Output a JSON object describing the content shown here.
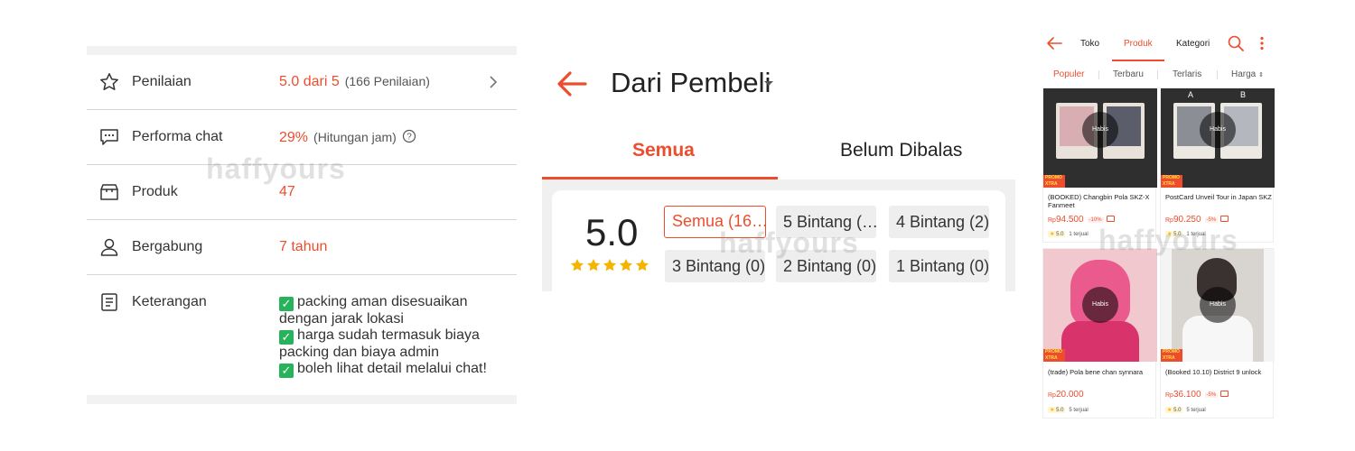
{
  "watermark": "haffyours",
  "shop_info": {
    "rows": [
      {
        "label": "Penilaian",
        "value": "5.0 dari 5",
        "sub": "(166 Penilaian)"
      },
      {
        "label": "Performa chat",
        "value": "29%",
        "sub": "(Hitungan jam)"
      },
      {
        "label": "Produk",
        "value": "47"
      },
      {
        "label": "Bergabung",
        "value": "7 tahun"
      },
      {
        "label": "Keterangan"
      }
    ],
    "description": [
      "packing aman disesuaikan",
      "dengan jarak lokasi",
      "harga sudah termasuk biaya",
      "packing dan biaya admin",
      "boleh lihat detail melalui chat!"
    ]
  },
  "ratings": {
    "title": "Dari Pembeli",
    "tabs": [
      "Semua",
      "Belum Dibalas"
    ],
    "score": "5.0",
    "stars": 5,
    "filters": [
      "Semua (16…",
      "5 Bintang (…",
      "4 Bintang (2)",
      "3 Bintang (0)",
      "2 Bintang (0)",
      "1 Bintang (0)"
    ]
  },
  "shop_nav": {
    "tabs": [
      "Toko",
      "Produk",
      "Kategori"
    ],
    "sort": [
      "Populer",
      "Terbaru",
      "Terlaris",
      "Harga"
    ],
    "products": [
      {
        "title": "(BOOKED) Changbin Pola SKZ-X Fanmeet",
        "currency": "Rp",
        "price": "94.500",
        "discount": "-10%",
        "rating": "5.0",
        "sold": "1 terjual",
        "status": "Habis",
        "badge": "PROMO XTRA"
      },
      {
        "title": "PostCard Unveil Tour in Japan SKZ",
        "currency": "Rp",
        "price": "90.250",
        "discount": "-5%",
        "rating": "5.0",
        "sold": "1 terjual",
        "status": "Habis",
        "badge": "PROMO XTRA",
        "img_labels": [
          "A",
          "B"
        ]
      },
      {
        "title": "(trade) Pola bene chan synnara",
        "currency": "Rp",
        "price": "20.000",
        "rating": "5.0",
        "sold": "5 terjual",
        "status": "Habis",
        "badge": "PROMO XTRA"
      },
      {
        "title": "(Booked 10.10) District 9 unlock",
        "currency": "Rp",
        "price": "36.100",
        "discount": "-5%",
        "rating": "5.0",
        "sold": "5 terjual",
        "status": "Habis",
        "badge": "PROMO XTRA"
      }
    ]
  },
  "colors": {
    "accent": "#ee4d2d",
    "star": "#f5b400",
    "check": "#27b35c"
  }
}
